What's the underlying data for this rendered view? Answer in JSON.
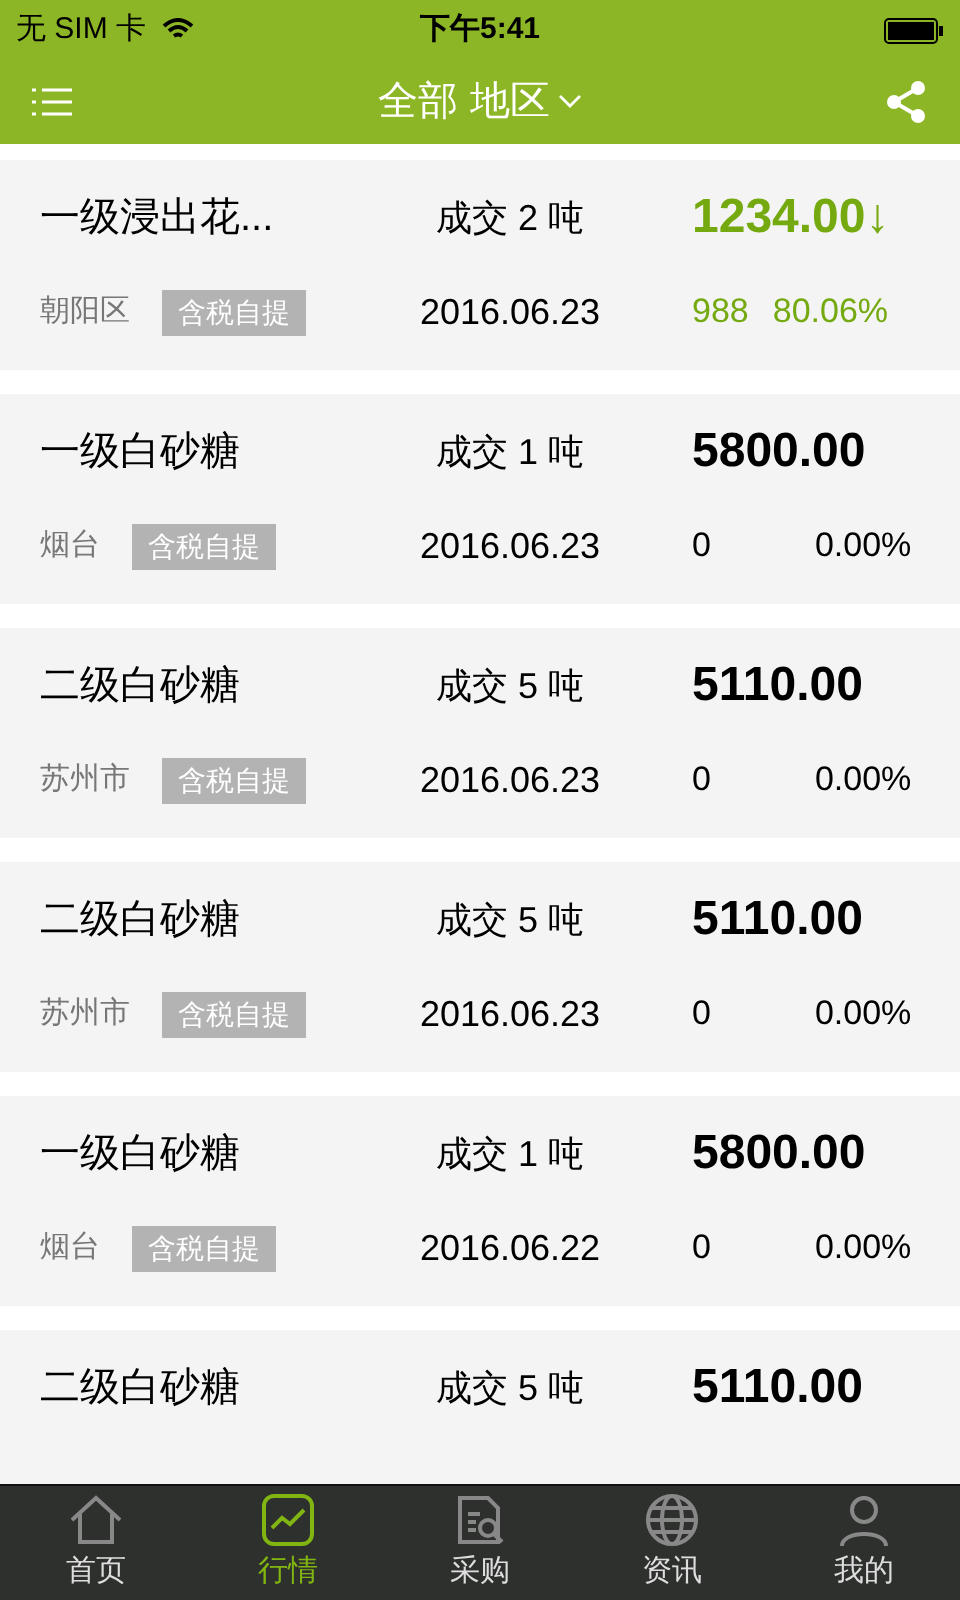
{
  "status_bar": {
    "carrier": "无 SIM 卡",
    "time": "下午5:41"
  },
  "header": {
    "title": "全部 地区"
  },
  "listings": [
    {
      "name": "一级浸出花...",
      "deal": "成交 2 吨",
      "price": "1234.00",
      "kind": "down",
      "trend_mark": "↓",
      "region": "朝阳区",
      "tag": "含税自提",
      "date": "2016.06.23",
      "change": "988",
      "percent": "80.06%"
    },
    {
      "name": "一级白砂糖",
      "deal": "成交 1 吨",
      "price": "5800.00",
      "kind": "flat",
      "region": "烟台",
      "tag": "含税自提",
      "date": "2016.06.23",
      "change": "0",
      "percent": "0.00%"
    },
    {
      "name": "二级白砂糖",
      "deal": "成交 5 吨",
      "price": "5110.00",
      "kind": "flat",
      "region": "苏州市",
      "tag": "含税自提",
      "date": "2016.06.23",
      "change": "0",
      "percent": "0.00%"
    },
    {
      "name": "二级白砂糖",
      "deal": "成交 5 吨",
      "price": "5110.00",
      "kind": "flat",
      "region": "苏州市",
      "tag": "含税自提",
      "date": "2016.06.23",
      "change": "0",
      "percent": "0.00%"
    },
    {
      "name": "一级白砂糖",
      "deal": "成交 1 吨",
      "price": "5800.00",
      "kind": "flat",
      "region": "烟台",
      "tag": "含税自提",
      "date": "2016.06.22",
      "change": "0",
      "percent": "0.00%"
    },
    {
      "name": "二级白砂糖",
      "deal": "成交 5 吨",
      "price": "5110.00",
      "kind": "flat"
    }
  ],
  "tab_bar": [
    {
      "label": "首页",
      "selected": false,
      "kind": "home"
    },
    {
      "label": "行情",
      "selected": true,
      "kind": "chart"
    },
    {
      "label": "采购",
      "selected": false,
      "kind": "purchase"
    },
    {
      "label": "资讯",
      "selected": false,
      "kind": "globe"
    },
    {
      "label": "我的",
      "selected": false,
      "kind": "user"
    }
  ]
}
